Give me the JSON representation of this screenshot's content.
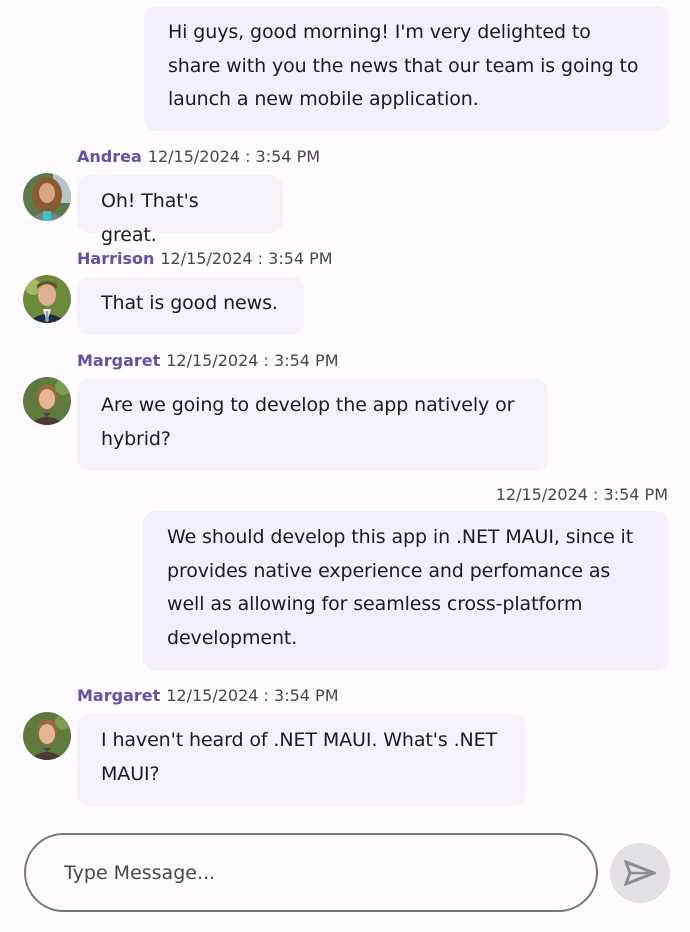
{
  "theme": {
    "background": "#fffbfe",
    "outgoing_bubble": "#f3effc",
    "incoming_bubble": "#f5f2fb",
    "author_color": "#6750a4",
    "meta_color": "#49454f"
  },
  "messages": [
    {
      "direction": "outgoing",
      "text": "Hi guys, good morning! I'm very delighted to share with you the news that our team is going to launch a new mobile application.",
      "lines": [
        "Hi guys, good morning! I'm very delighted to",
        "share with you the news that our team is going to",
        "launch a new mobile application."
      ]
    },
    {
      "direction": "incoming",
      "author": "Andrea",
      "timestamp": "12/15/2024 : 3:54 PM",
      "text": "Oh! That's great.",
      "avatar": "avatar-andrea"
    },
    {
      "direction": "incoming",
      "author": "Harrison",
      "timestamp": "12/15/2024 : 3:54 PM",
      "text": "That is good news.",
      "avatar": "avatar-harrison"
    },
    {
      "direction": "incoming",
      "author": "Margaret",
      "timestamp": "12/15/2024 : 3:54 PM",
      "text": "Are we going to develop the app natively or hybrid?",
      "lines": [
        "Are we going to develop the app natively or",
        "hybrid?"
      ],
      "avatar": "avatar-margaret"
    },
    {
      "direction": "outgoing",
      "timestamp": "12/15/2024 : 3:54 PM",
      "text": "We should develop this app in .NET MAUI, since it provides native experience and perfomance as well as allowing for seamless cross-platform development.",
      "lines": [
        "We should develop this app in .NET MAUI, since it",
        "provides native experience and perfomance as",
        "well as allowing for seamless cross-platform",
        "development."
      ]
    },
    {
      "direction": "incoming",
      "author": "Margaret",
      "timestamp": "12/15/2024 : 3:54 PM",
      "text": "I haven't heard of .NET MAUI. What's .NET MAUI?",
      "lines": [
        "I haven't heard of .NET MAUI. What's .NET",
        "MAUI?"
      ],
      "avatar": "avatar-margaret"
    }
  ],
  "composer": {
    "placeholder": "Type Message...",
    "value": "",
    "send_icon": "send-icon"
  }
}
